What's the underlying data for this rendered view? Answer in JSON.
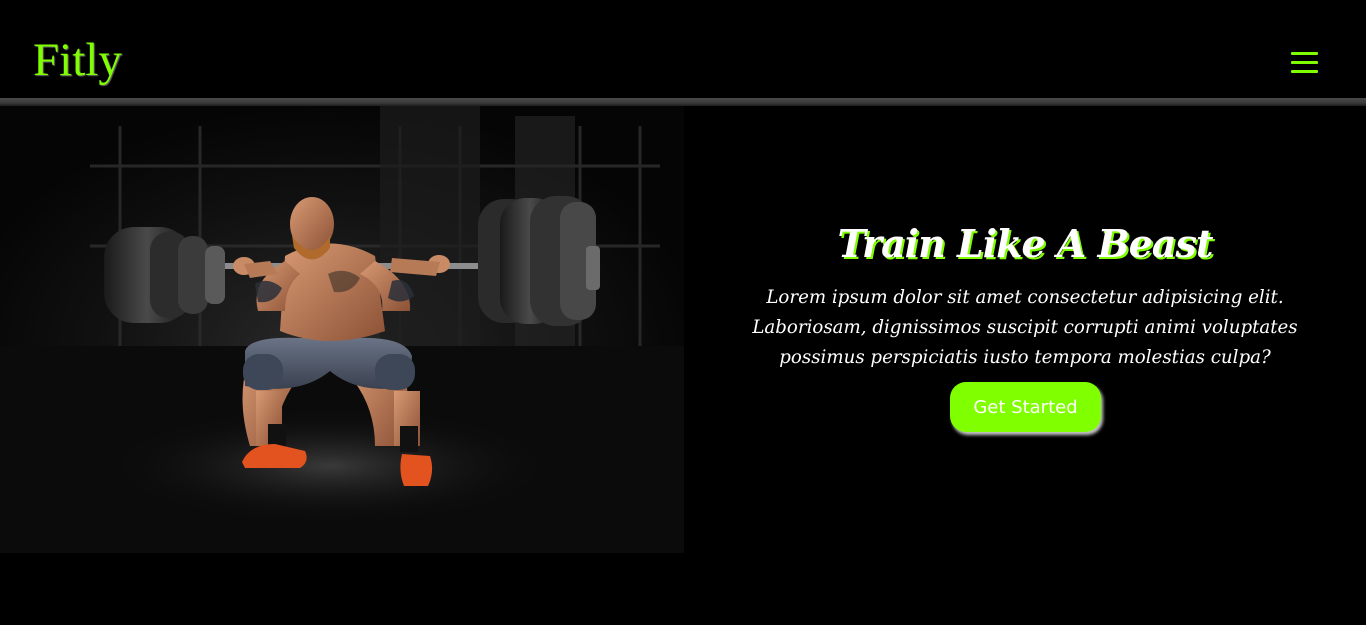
{
  "navbar": {
    "brand": "Fitly",
    "menu_icon": "hamburger-menu-icon"
  },
  "hero": {
    "title": "Train Like A Beast",
    "description": "Lorem ipsum dolor sit amet consectetur adipisicing elit. Laboriosam, dignissimos suscipit corrupti animi voluptates possimus perspiciatis iusto tempora molestias culpa?",
    "button_label": "Get Started"
  },
  "colors": {
    "accent": "#7fff00",
    "background": "#000000",
    "text": "#ffffff",
    "divider": "#3a3a3a"
  }
}
